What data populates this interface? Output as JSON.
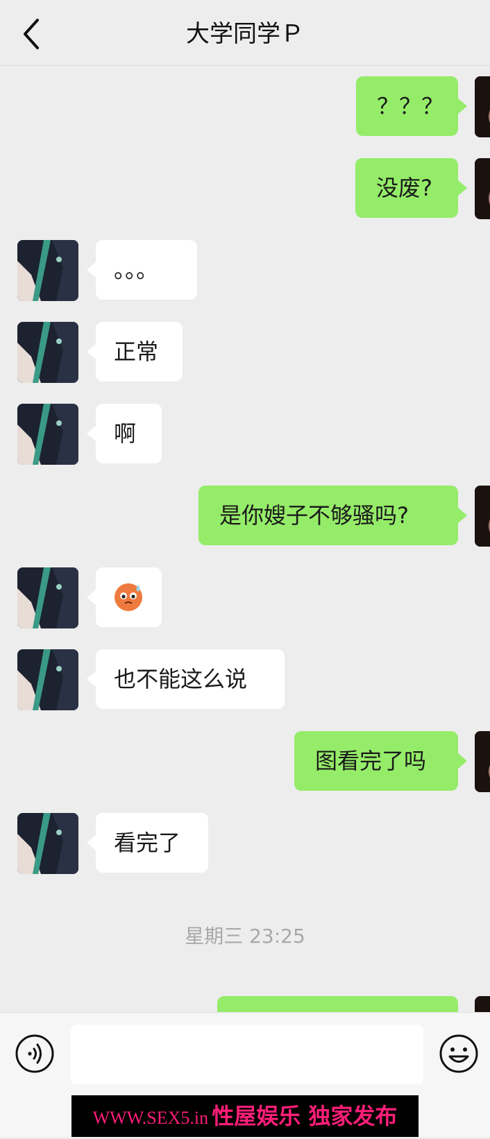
{
  "header": {
    "title": "大学同学Ｐ"
  },
  "messages": [
    {
      "side": "out",
      "text": "？？？"
    },
    {
      "side": "out",
      "text": "没废?"
    },
    {
      "side": "in",
      "text": "。。。"
    },
    {
      "side": "in",
      "text": "正常"
    },
    {
      "side": "in",
      "text": "啊"
    },
    {
      "side": "out",
      "text": "是你嫂子不够骚吗?"
    },
    {
      "side": "in",
      "emoji": "sweating-face-emoji"
    },
    {
      "side": "in",
      "text": "也不能这么说"
    },
    {
      "side": "out",
      "text": "图看完了吗"
    },
    {
      "side": "in",
      "text": "看完了"
    }
  ],
  "timestamp": "星期三 23:25",
  "colors": {
    "outgoing_bubble": "#95ec69",
    "incoming_bubble": "#ffffff",
    "background": "#ededed"
  },
  "icons": {
    "back": "chevron-left-icon",
    "voice": "voice-icon",
    "emoji": "emoji-smile-icon"
  },
  "watermark": {
    "url": "WWW.SEX5.in",
    "text": "性屋娱乐 独家发布"
  }
}
